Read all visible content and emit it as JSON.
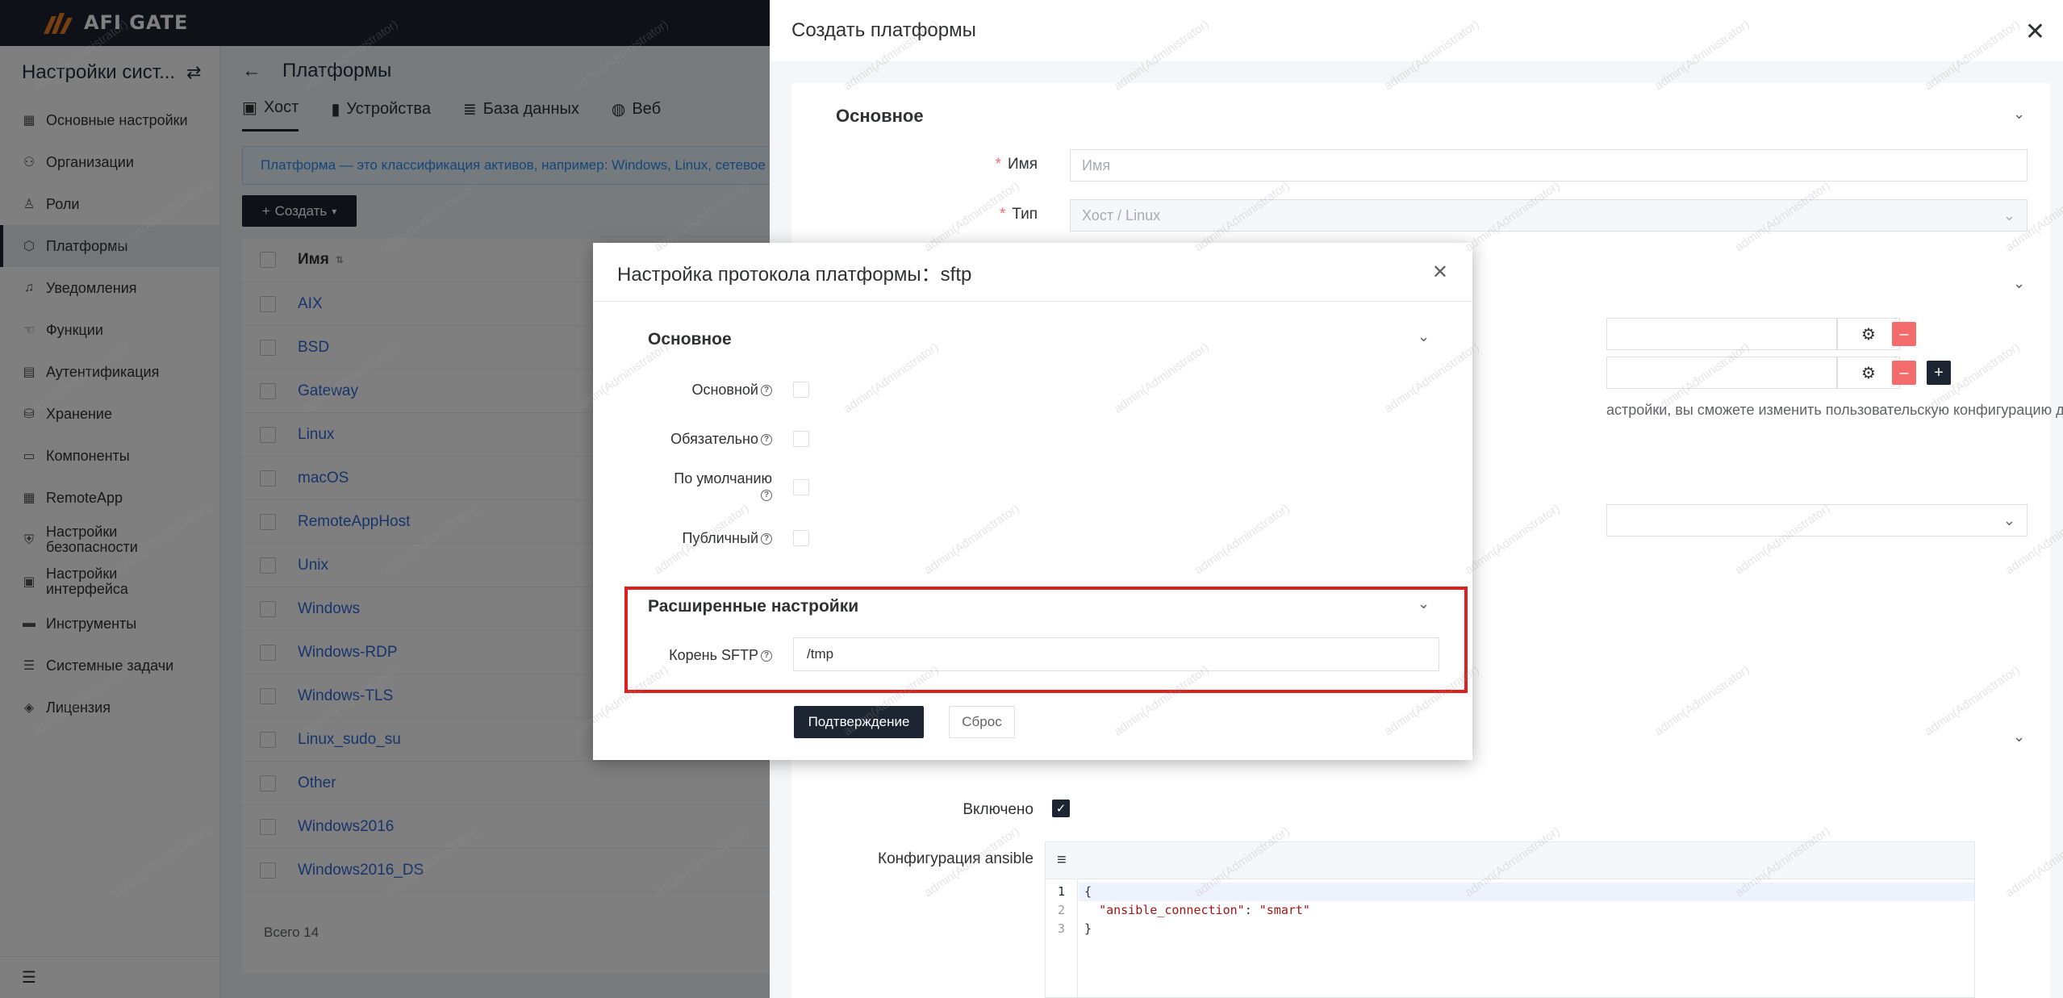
{
  "app": {
    "logo_text": "AFI GATE"
  },
  "sidebar": {
    "title": "Настройки сист...",
    "items": [
      {
        "label": "Основные настройки",
        "icon": "grid-icon"
      },
      {
        "label": "Организации",
        "icon": "org-icon"
      },
      {
        "label": "Роли",
        "icon": "shirt-icon"
      },
      {
        "label": "Платформы",
        "icon": "cube-icon",
        "active": true
      },
      {
        "label": "Уведомления",
        "icon": "bell-icon"
      },
      {
        "label": "Функции",
        "icon": "hand-icon"
      },
      {
        "label": "Аутентификация",
        "icon": "id-card-icon"
      },
      {
        "label": "Хранение",
        "icon": "storage-icon"
      },
      {
        "label": "Компоненты",
        "icon": "monitor-icon"
      },
      {
        "label": "RemoteApp",
        "icon": "app-grid-icon"
      },
      {
        "label": "Настройки безопасности",
        "icon": "shield-icon"
      },
      {
        "label": "Настройки интерфейса",
        "icon": "interface-icon"
      },
      {
        "label": "Инструменты",
        "icon": "toolbox-icon"
      },
      {
        "label": "Системные задачи",
        "icon": "tasks-icon"
      },
      {
        "label": "Лицензия",
        "icon": "license-icon"
      }
    ]
  },
  "page": {
    "title": "Платформы",
    "tabs": [
      {
        "label": "Хост",
        "active": true
      },
      {
        "label": "Устройства"
      },
      {
        "label": "База данных"
      },
      {
        "label": "Веб"
      }
    ],
    "info": "Платформа — это классификация активов, например: Windows, Linux, сетевое оборудование и т.д.",
    "create_button": "Создать",
    "table": {
      "column_name": "Имя",
      "rows": [
        "AIX",
        "BSD",
        "Gateway",
        "Linux",
        "macOS",
        "RemoteAppHost",
        "Unix",
        "Windows",
        "Windows-RDP",
        "Windows-TLS",
        "Linux_sudo_su",
        "Other",
        "Windows2016",
        "Windows2016_DS"
      ],
      "total": "Всего 14"
    }
  },
  "drawer": {
    "title": "Создать платформы",
    "basic_section": "Основное",
    "name_label": "Имя",
    "name_placeholder": "Имя",
    "type_label": "Тип",
    "type_value": "Хост / Linux",
    "protocol_hint": "астройки, вы сможете изменить пользовательскую конфигурацию для",
    "enabled_label": "Включено",
    "ansible_label": "Конфигурация ansible",
    "code_lines": [
      "1",
      "2",
      "3"
    ],
    "code": {
      "open": "{",
      "key": "\"ansible_connection\"",
      "sep": ": ",
      "value": "\"smart\"",
      "close": "}"
    }
  },
  "dialog": {
    "title": "Настройка протокола платформы：sftp",
    "basic_section": "Основное",
    "fields": [
      {
        "label": "Основной"
      },
      {
        "label": "Обязательно"
      },
      {
        "label": "По умолчанию"
      },
      {
        "label": "Публичный"
      }
    ],
    "advanced_section": "Расширенные настройки",
    "sftp_root_label": "Корень SFTP",
    "sftp_root_value": "/tmp",
    "confirm_button": "Подтверждение",
    "reset_button": "Сброс"
  },
  "watermark": "admin(Administrator)",
  "colors": {
    "primary": "#1c2531",
    "danger": "#f56c6c",
    "highlight": "#e02020",
    "link": "#2d6ad8"
  }
}
